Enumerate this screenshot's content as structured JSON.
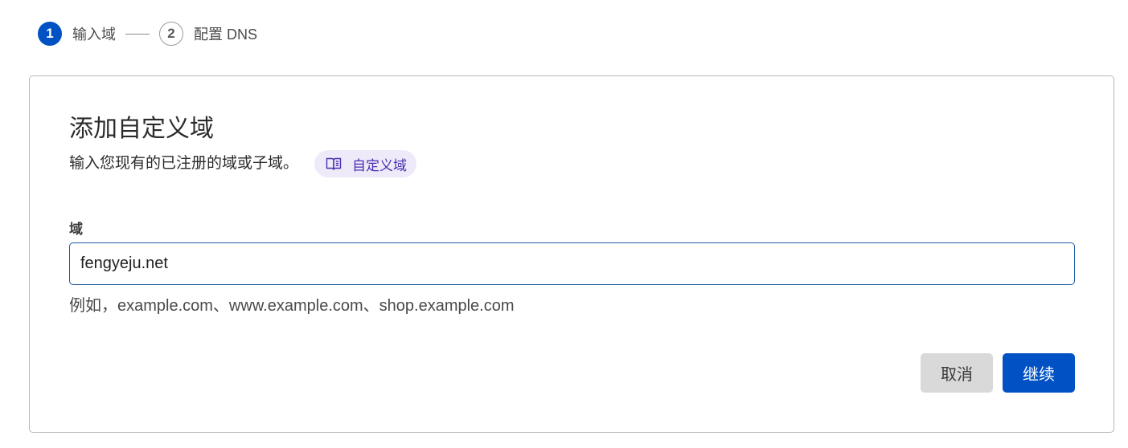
{
  "stepper": {
    "steps": [
      {
        "number": "1",
        "label": "输入域",
        "state": "active"
      },
      {
        "number": "2",
        "label": "配置 DNS",
        "state": "inactive"
      }
    ]
  },
  "card": {
    "title": "添加自定义域",
    "subtitle": "输入您现有的已注册的域或子域。",
    "doc_link": {
      "label": "自定义域",
      "icon": "book-open-icon"
    }
  },
  "form": {
    "domain_label": "域",
    "domain_value": "fengyeju.net",
    "domain_hint": "例如，example.com、www.example.com、shop.example.com"
  },
  "actions": {
    "cancel_label": "取消",
    "continue_label": "继续"
  },
  "colors": {
    "primary": "#0051c3",
    "chip_bg": "#eeeaf9",
    "chip_text": "#4b2fb0",
    "cancel_bg": "#d9d9d9"
  }
}
